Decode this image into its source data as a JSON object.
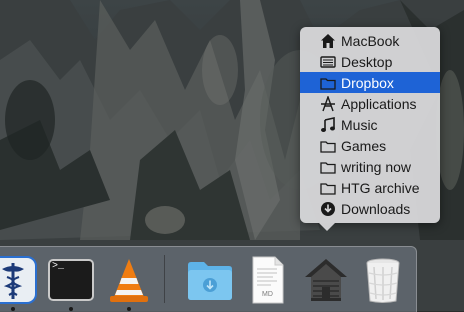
{
  "stack_menu": {
    "items": [
      {
        "label": "MacBook",
        "icon": "home-icon",
        "selected": false
      },
      {
        "label": "Desktop",
        "icon": "desktop-icon",
        "selected": false
      },
      {
        "label": "Dropbox",
        "icon": "folder-icon",
        "selected": true
      },
      {
        "label": "Applications",
        "icon": "applications-icon",
        "selected": false
      },
      {
        "label": "Music",
        "icon": "music-note-icon",
        "selected": false
      },
      {
        "label": "Games",
        "icon": "folder-icon",
        "selected": false
      },
      {
        "label": "writing now",
        "icon": "folder-icon",
        "selected": false
      },
      {
        "label": "HTG archive",
        "icon": "folder-icon",
        "selected": false
      },
      {
        "label": "Downloads",
        "icon": "download-circle-icon",
        "selected": false
      }
    ],
    "selected_color": "#1e63d6"
  },
  "dock": {
    "apps": [
      {
        "name": "medical-app-icon"
      },
      {
        "name": "terminal-app-icon",
        "prompt": ">_"
      },
      {
        "name": "vlc-app-icon"
      }
    ],
    "stacks": [
      {
        "name": "downloads-folder-icon"
      },
      {
        "name": "markdown-file-icon",
        "badge": "MD"
      },
      {
        "name": "home-stack-icon"
      },
      {
        "name": "trash-icon"
      }
    ]
  }
}
